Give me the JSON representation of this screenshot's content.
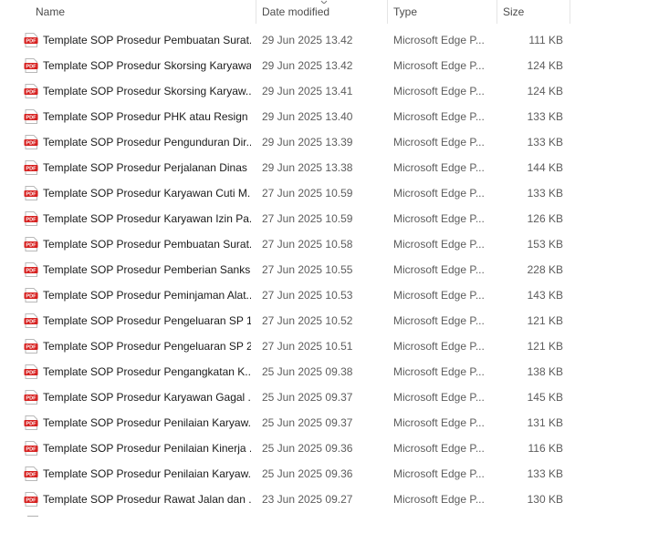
{
  "columns": {
    "name": "Name",
    "date_modified": "Date modified",
    "type": "Type",
    "size": "Size"
  },
  "sort": {
    "column": "date_modified",
    "direction": "descending"
  },
  "icons": {
    "file": "pdf-file-icon",
    "sort": "chevron-down-icon"
  },
  "colors": {
    "pdf_icon": "#d6201f"
  },
  "files": [
    {
      "name": "Template SOP Prosedur Pembuatan Surat...",
      "date": "29 Jun 2025 13.42",
      "type": "Microsoft Edge P...",
      "size": "111 KB"
    },
    {
      "name": "Template SOP Prosedur Skorsing Karyawan",
      "date": "29 Jun 2025 13.42",
      "type": "Microsoft Edge P...",
      "size": "124 KB"
    },
    {
      "name": "Template SOP Prosedur Skorsing Karyaw...",
      "date": "29 Jun 2025 13.41",
      "type": "Microsoft Edge P...",
      "size": "124 KB"
    },
    {
      "name": "Template SOP Prosedur  PHK atau Resign",
      "date": "29 Jun 2025 13.40",
      "type": "Microsoft Edge P...",
      "size": "133 KB"
    },
    {
      "name": "Template SOP Prosedur Pengunduran Dir...",
      "date": "29 Jun 2025 13.39",
      "type": "Microsoft Edge P...",
      "size": "133 KB"
    },
    {
      "name": "Template SOP Prosedur Perjalanan Dinas ...",
      "date": "29 Jun 2025 13.38",
      "type": "Microsoft Edge P...",
      "size": "144 KB"
    },
    {
      "name": "Template SOP Prosedur Karyawan Cuti M...",
      "date": "27 Jun 2025 10.59",
      "type": "Microsoft Edge P...",
      "size": "133 KB"
    },
    {
      "name": "Template SOP Prosedur Karyawan Izin Pa...",
      "date": "27 Jun 2025 10.59",
      "type": "Microsoft Edge P...",
      "size": "126 KB"
    },
    {
      "name": "Template SOP Prosedur Pembuatan Surat...",
      "date": "27 Jun 2025 10.58",
      "type": "Microsoft Edge P...",
      "size": "153 KB"
    },
    {
      "name": "Template SOP Prosedur Pemberian Sanks...",
      "date": "27 Jun 2025 10.55",
      "type": "Microsoft Edge P...",
      "size": "228 KB"
    },
    {
      "name": "Template SOP Prosedur Peminjaman Alat...",
      "date": "27 Jun 2025 10.53",
      "type": "Microsoft Edge P...",
      "size": "143 KB"
    },
    {
      "name": "Template SOP Prosedur Pengeluaran SP 1...",
      "date": "27 Jun 2025 10.52",
      "type": "Microsoft Edge P...",
      "size": "121 KB"
    },
    {
      "name": "Template SOP Prosedur Pengeluaran SP 2...",
      "date": "27 Jun 2025 10.51",
      "type": "Microsoft Edge P...",
      "size": "121 KB"
    },
    {
      "name": "Template SOP Prosedur Pengangkatan K...",
      "date": "25 Jun 2025 09.38",
      "type": "Microsoft Edge P...",
      "size": "138 KB"
    },
    {
      "name": "Template SOP Prosedur Karyawan Gagal ...",
      "date": "25 Jun 2025 09.37",
      "type": "Microsoft Edge P...",
      "size": "145 KB"
    },
    {
      "name": "Template SOP Prosedur Penilaian Karyaw...",
      "date": "25 Jun 2025 09.37",
      "type": "Microsoft Edge P...",
      "size": "131 KB"
    },
    {
      "name": "Template SOP Prosedur Penilaian Kinerja ...",
      "date": "25 Jun 2025 09.36",
      "type": "Microsoft Edge P...",
      "size": "116 KB"
    },
    {
      "name": "Template SOP Prosedur Penilaian Karyaw...",
      "date": "25 Jun 2025 09.36",
      "type": "Microsoft Edge P...",
      "size": "133 KB"
    },
    {
      "name": "Template SOP Prosedur Rawat Jalan dan ...",
      "date": "23 Jun 2025 09.27",
      "type": "Microsoft Edge P...",
      "size": "130 KB"
    }
  ]
}
